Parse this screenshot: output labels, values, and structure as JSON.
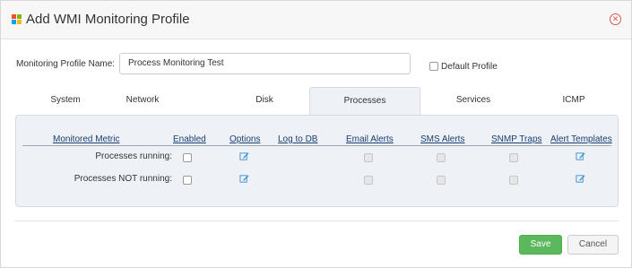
{
  "dialog": {
    "title": "Add WMI Monitoring Profile",
    "icon": "windows-logo-icon",
    "close_icon": "close-icon"
  },
  "form": {
    "name_label": "Monitoring Profile Name:",
    "name_value": "Process Monitoring Test",
    "default_label": "Default Profile",
    "default_checked": false
  },
  "tabs": [
    {
      "label": "System",
      "active": false
    },
    {
      "label": "Network",
      "active": false
    },
    {
      "label": "Disk",
      "active": false
    },
    {
      "label": "Processes",
      "active": true
    },
    {
      "label": "Services",
      "active": false
    },
    {
      "label": "ICMP",
      "active": false
    }
  ],
  "table": {
    "headers": [
      "Monitored Metric",
      "Enabled",
      "Options",
      "Log to DB",
      "Email Alerts",
      "SMS Alerts",
      "SNMP Traps",
      "Alert Templates"
    ],
    "rows": [
      {
        "label": "Processes running:",
        "enabled": false
      },
      {
        "label": "Processes NOT running:",
        "enabled": false
      }
    ],
    "edit_icon": "edit-icon"
  },
  "footer": {
    "save_label": "Save",
    "cancel_label": "Cancel"
  },
  "colors": {
    "save_button": "#5cb85c",
    "header_text": "#1a3d6e",
    "panel_bg": "#eef2f6",
    "close_icon": "#d9534f"
  }
}
